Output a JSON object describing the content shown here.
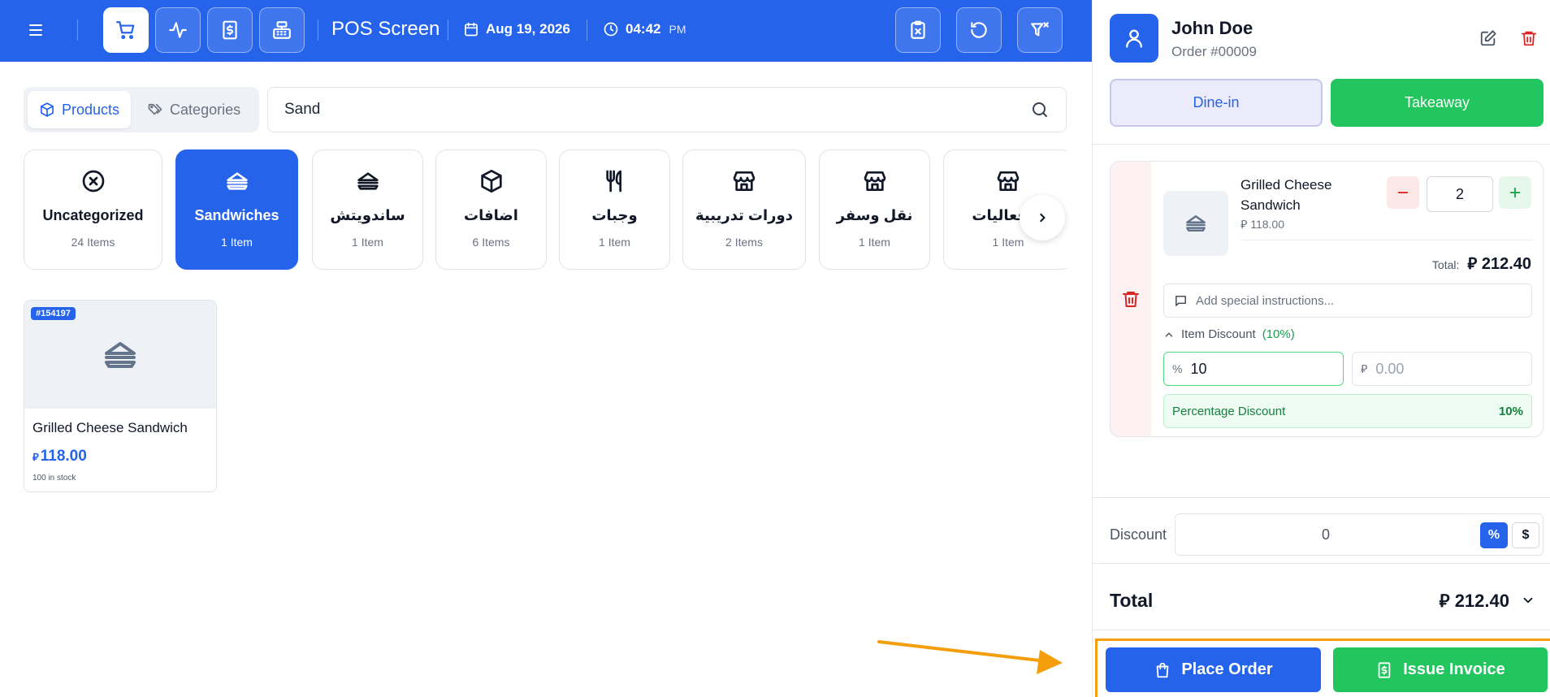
{
  "header": {
    "title": "POS Screen",
    "date": "Aug 19, 2026",
    "time": "04:42",
    "ampm": "PM",
    "nav_icons": [
      "cart-icon",
      "activity-icon",
      "receipt-dollar-icon",
      "cash-register-icon"
    ],
    "action_icons": [
      "clipboard-x-icon",
      "refresh-icon",
      "filter-x-icon"
    ]
  },
  "view_toggle": {
    "products": "Products",
    "categories": "Categories"
  },
  "search": {
    "value": "Sand"
  },
  "categories": [
    {
      "name": "Uncategorized",
      "count": "24 Items",
      "icon": "circle-x-icon",
      "active": false
    },
    {
      "name": "Sandwiches",
      "count": "1 Item",
      "icon": "sandwich-icon",
      "active": true
    },
    {
      "name": "ساندويتش",
      "count": "1 Item",
      "icon": "sandwich-icon",
      "active": false
    },
    {
      "name": "اضافات",
      "count": "6 Items",
      "icon": "box-icon",
      "active": false
    },
    {
      "name": "وجبات",
      "count": "1 Item",
      "icon": "utensils-icon",
      "active": false
    },
    {
      "name": "دورات تدريبية",
      "count": "2 Items",
      "icon": "store-icon",
      "active": false
    },
    {
      "name": "نقل وسفر",
      "count": "1 Item",
      "icon": "store-icon",
      "active": false
    },
    {
      "name": "ي فعاليات",
      "count": "1 Item",
      "icon": "store-icon",
      "active": false
    }
  ],
  "products": [
    {
      "sku": "#154197",
      "name": "Grilled Cheese Sandwich",
      "currency": "⃁",
      "price": "118.00",
      "stock": "100 in stock"
    }
  ],
  "customer": {
    "name": "John Doe",
    "order_number": "Order #00009"
  },
  "order_type": {
    "dine_in": "Dine-in",
    "takeaway": "Takeaway",
    "selected": "Takeaway"
  },
  "cart_item": {
    "name": "Grilled Cheese Sandwich",
    "unit_price": "⃁ 118.00",
    "quantity": "2",
    "total_label": "Total:",
    "total_value": "⃁ 212.40",
    "instructions_placeholder": "Add special instructions...",
    "discount_toggle_label": "Item Discount",
    "discount_toggle_value": "(10%)",
    "discount_percent_symbol": "%",
    "discount_percent_value": "10",
    "discount_amount_symbol": "⃁",
    "discount_amount_placeholder": "0.00",
    "discount_type_label": "Percentage Discount",
    "discount_type_value": "10%"
  },
  "order_discount": {
    "label": "Discount",
    "value": "0",
    "percent_btn": "%",
    "amount_btn": "$"
  },
  "summary": {
    "total_label": "Total",
    "total_value": "⃁ 212.40"
  },
  "actions": {
    "place_order": "Place Order",
    "issue_invoice": "Issue Invoice"
  },
  "colors": {
    "primary": "#2563eb",
    "success": "#22c55e",
    "danger": "#dc2626",
    "highlight": "#f59e0b"
  }
}
